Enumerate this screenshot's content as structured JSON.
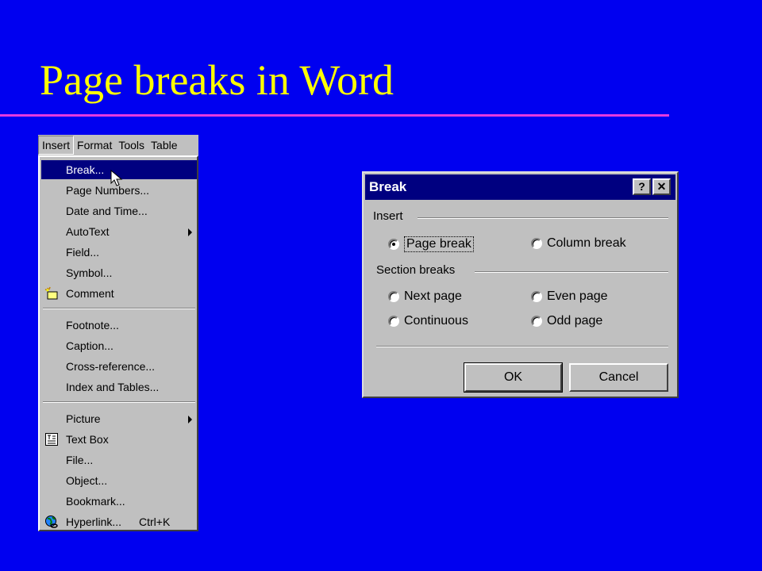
{
  "slide": {
    "title": "Page breaks in Word"
  },
  "menubar": {
    "items": [
      {
        "label": "Insert"
      },
      {
        "label": "Format"
      },
      {
        "label": "Tools"
      },
      {
        "label": "Table"
      }
    ]
  },
  "insert_menu": {
    "items": [
      {
        "label": "Break..."
      },
      {
        "label": "Page Numbers..."
      },
      {
        "label": "Date and Time..."
      },
      {
        "label": "AutoText"
      },
      {
        "label": "Field..."
      },
      {
        "label": "Symbol..."
      },
      {
        "label": "Comment",
        "icon": "comment-icon"
      },
      {
        "label": "Footnote..."
      },
      {
        "label": "Caption..."
      },
      {
        "label": "Cross-reference..."
      },
      {
        "label": "Index and Tables..."
      },
      {
        "label": "Picture"
      },
      {
        "label": "Text Box",
        "icon": "text-box-icon"
      },
      {
        "label": "File..."
      },
      {
        "label": "Object..."
      },
      {
        "label": "Bookmark..."
      },
      {
        "label": "Hyperlink...",
        "shortcut": "Ctrl+K",
        "icon": "globe-link-icon"
      }
    ]
  },
  "dialog": {
    "title": "Break",
    "help_label": "?",
    "close_label": "✕",
    "insert_group": "Insert",
    "page_break": "Page break",
    "column_break": "Column break",
    "section_group": "Section breaks",
    "next_page": "Next page",
    "even_page": "Even page",
    "continuous": "Continuous",
    "odd_page": "Odd page",
    "ok": "OK",
    "cancel": "Cancel",
    "selected_option": "Page break"
  },
  "colors": {
    "background": "#0000f0",
    "title": "#ffff00",
    "rule": "#e43adf",
    "highlight": "#000080",
    "face": "#c0c0c0"
  }
}
